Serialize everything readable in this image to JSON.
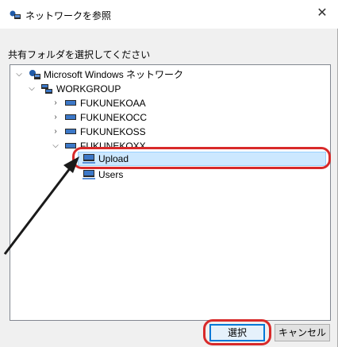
{
  "window": {
    "title": "ネットワークを参照",
    "close_glyph": "✕"
  },
  "prompt": "共有フォルダを選択してください",
  "tree": {
    "root": "Microsoft Windows ネットワーク",
    "group": "WORKGROUP",
    "computers": [
      "FUKUNEKOAA",
      "FUKUNEKOCC",
      "FUKUNEKOSS",
      "FUKUNEKOXX"
    ],
    "shares": [
      "Upload",
      "Users"
    ],
    "selected": "Upload"
  },
  "buttons": {
    "ok": "選択",
    "cancel": "キャンセル"
  },
  "colors": {
    "selection_bg": "#cce8ff",
    "annotation": "#d82a2a",
    "arrow": "#1a1a1a",
    "default_button_border": "#0078d7"
  },
  "icons": {
    "network": "network-icon",
    "workgroup": "workgroup-icon",
    "computer": "computer-icon",
    "share": "shared-folder-icon"
  }
}
